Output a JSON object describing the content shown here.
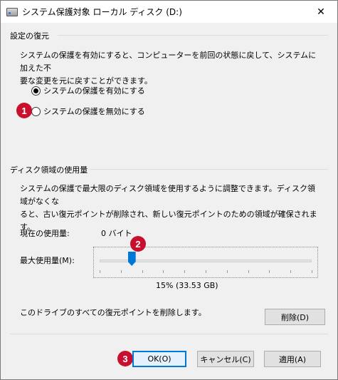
{
  "window": {
    "title": "システム保護対象 ローカル ディスク (D:)",
    "close_glyph": "✕"
  },
  "restore": {
    "heading": "設定の復元",
    "desc_line1": "システムの保護を有効にすると、コンピューターを前回の状態に戻して、システムに加えた不",
    "desc_line2": "要な変更を元に戻すことができます。",
    "option_on": "システムの保護を有効にする",
    "option_off": "システムの保護を無効にする",
    "selected": "option_on"
  },
  "usage": {
    "heading": "ディスク領域の使用量",
    "desc_line1": "システムの保護で最大限のディスク領域を使用するように調整できます。ディスク領域がなくな",
    "desc_line2": "ると、古い復元ポイントが削除され、新しい復元ポイントのための領域が確保されます。",
    "current_label": "現在の使用量:",
    "current_value": "0 バイト",
    "max_label": "最大使用量(M):",
    "max_percent": 15,
    "max_value_text": "15% (33.53 GB)",
    "delete_desc": "このドライブのすべての復元ポイントを削除します。",
    "delete_button": "削除(D)"
  },
  "footer": {
    "ok": "OK(O)",
    "cancel": "キャンセル(C)",
    "apply": "適用(A)"
  },
  "badges": [
    "1",
    "2",
    "3"
  ],
  "colors": {
    "badge": "#c8102e",
    "accent": "#0078d7"
  }
}
